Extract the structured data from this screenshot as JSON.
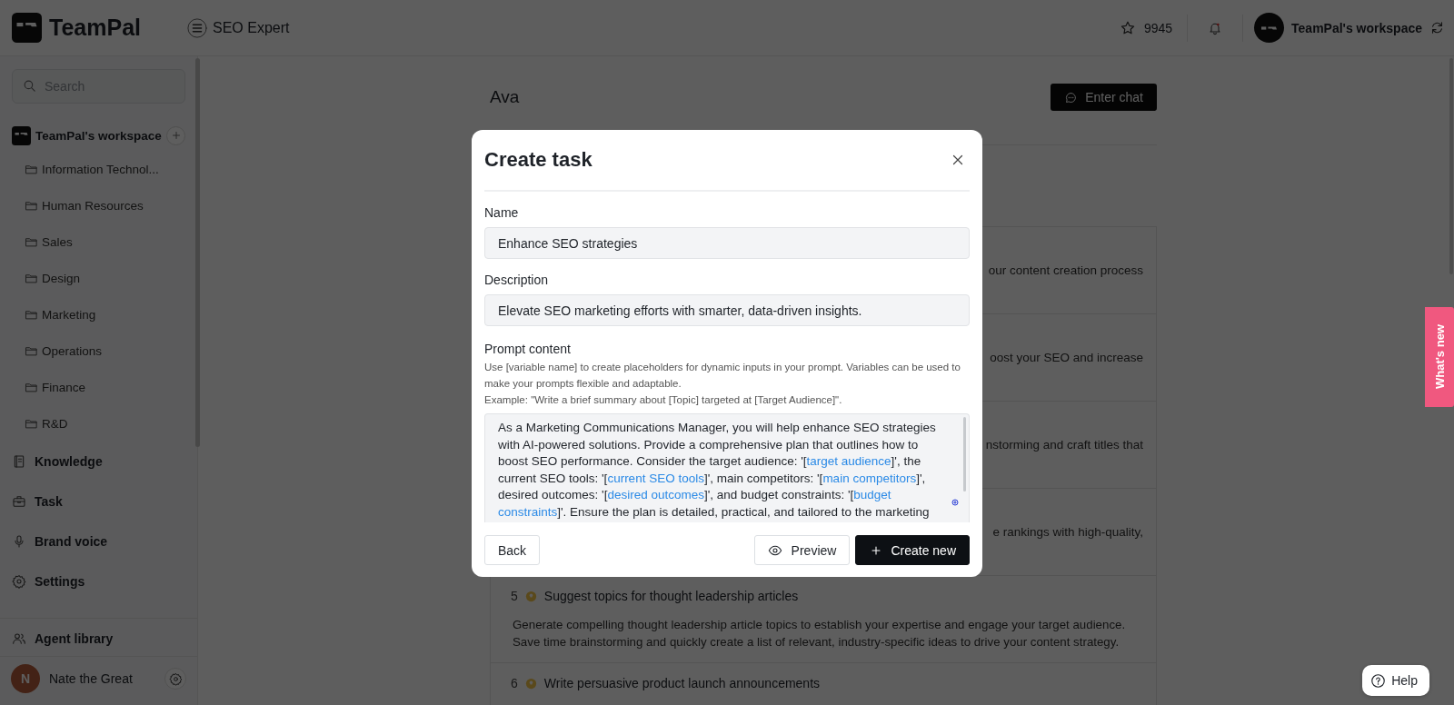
{
  "header": {
    "logo": "TeamPal",
    "agent_title": "SEO Expert",
    "credits": "9945",
    "workspace": "TeamPal's workspace"
  },
  "sidebar": {
    "search": {
      "placeholder": "Search"
    },
    "workspace": {
      "name": "TeamPal's workspace",
      "folders": [
        {
          "label": "Information Technol..."
        },
        {
          "label": "Human Resources"
        },
        {
          "label": "Sales"
        },
        {
          "label": "Design"
        },
        {
          "label": "Marketing"
        },
        {
          "label": "Operations"
        },
        {
          "label": "Finance"
        },
        {
          "label": "R&D"
        }
      ]
    },
    "nav": [
      {
        "label": "Knowledge",
        "kind": "knowledge"
      },
      {
        "label": "Task",
        "kind": "task"
      },
      {
        "label": "Brand voice",
        "kind": "voice"
      },
      {
        "label": "Settings",
        "kind": "settings"
      }
    ],
    "agent_library": "Agent library",
    "user": {
      "initial": "N",
      "name": "Nate the Great"
    }
  },
  "agent": {
    "name": "Ava",
    "enter_chat": "Enter chat",
    "tasks": [
      {
        "visible_text": "our content creation process"
      },
      {
        "visible_text": "oost your SEO and increase"
      },
      {
        "visible_text": "nstorming and craft titles that"
      },
      {
        "visible_text": "e rankings with high-quality,"
      },
      {
        "number": "5",
        "title": "Suggest topics for thought leadership articles",
        "description": "Generate compelling thought leadership article topics to establish your expertise and engage your target audience. Save time brainstorming and quickly create a list of relevant, industry-specific ideas to drive your content strategy."
      },
      {
        "number": "6",
        "title": "Write persuasive product launch announcements"
      }
    ]
  },
  "modal": {
    "title": "Create task",
    "name": {
      "label": "Name",
      "value": "Enhance SEO strategies"
    },
    "description": {
      "label": "Description",
      "value": "Elevate SEO marketing efforts with smarter, data-driven insights."
    },
    "prompt": {
      "label": "Prompt content",
      "help": [
        "Use [variable name] to create placeholders for dynamic inputs in your prompt. Variables can be used to make your prompts flexible and adaptable.",
        "Example: \"Write a brief summary about [Topic] targeted at [Target Audience]\"."
      ],
      "segments": [
        {
          "kind": "plain",
          "text": "As a Marketing Communications Manager, you will help enhance SEO strategies with AI-powered solutions. Provide a comprehensive plan that outlines how to boost SEO performance. Consider the target audience: '["
        },
        {
          "kind": "variable",
          "text": "target audience"
        },
        {
          "kind": "plain",
          "text": "]', the current SEO tools: '["
        },
        {
          "kind": "variable",
          "text": "current SEO tools"
        },
        {
          "kind": "plain",
          "text": "]', main competitors: '["
        },
        {
          "kind": "variable",
          "text": "main competitors"
        },
        {
          "kind": "plain",
          "text": "]', desired outcomes: '["
        },
        {
          "kind": "variable",
          "text": "desired outcomes"
        },
        {
          "kind": "plain",
          "text": "]', and budget constraints: '["
        },
        {
          "kind": "variable",
          "text": "budget constraints"
        },
        {
          "kind": "plain",
          "text": "]'. Ensure the plan is detailed, practical, and tailored to the marketing"
        }
      ]
    },
    "buttons": {
      "back": "Back",
      "preview": "Preview",
      "create": "Create new"
    }
  },
  "whats_new": "What's new",
  "help": "Help"
}
